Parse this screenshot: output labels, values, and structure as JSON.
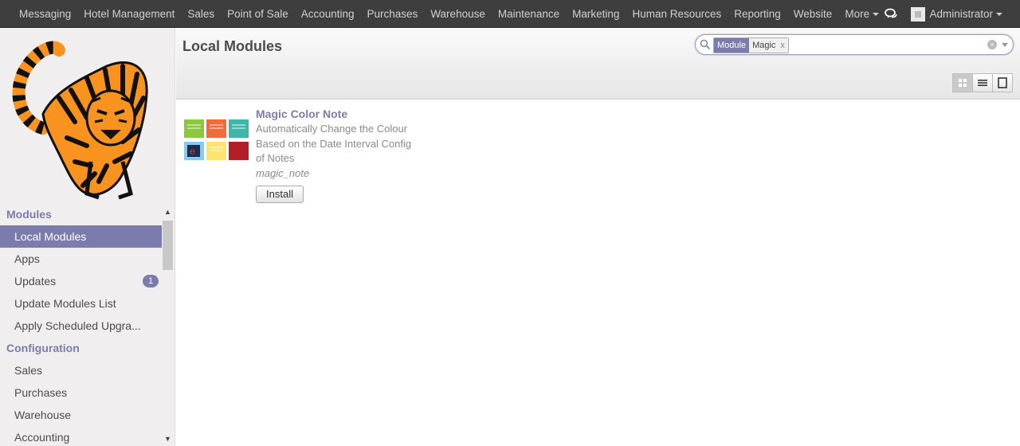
{
  "topnav": {
    "items": [
      "Messaging",
      "Hotel Management",
      "Sales",
      "Point of Sale",
      "Accounting",
      "Purchases",
      "Warehouse",
      "Maintenance",
      "Marketing",
      "Human Resources",
      "Reporting",
      "Website"
    ],
    "more_label": "More",
    "user_name": "Administrator"
  },
  "sidebar": {
    "sections": [
      {
        "title": "Modules",
        "items": [
          {
            "label": "Local Modules",
            "active": true
          },
          {
            "label": "Apps"
          },
          {
            "label": "Updates",
            "badge": "1"
          },
          {
            "label": "Update Modules List"
          },
          {
            "label": "Apply Scheduled Upgra..."
          }
        ]
      },
      {
        "title": "Configuration",
        "items": [
          {
            "label": "Sales"
          },
          {
            "label": "Purchases"
          },
          {
            "label": "Warehouse"
          },
          {
            "label": "Accounting"
          }
        ]
      }
    ]
  },
  "header": {
    "title": "Local Modules",
    "search": {
      "facet_category": "Module",
      "facet_value": "Magic",
      "facet_remove": "x",
      "value": ""
    }
  },
  "module": {
    "name": "Magic Color Note",
    "summary": "Automatically Change the Colour Based on the Date Interval Config of Notes",
    "technical_name": "magic_note",
    "install_label": "Install"
  },
  "colors": {
    "accent": "#7c7bad",
    "topbar": "#3e3e3e",
    "sidebar": "#f0eeee"
  }
}
